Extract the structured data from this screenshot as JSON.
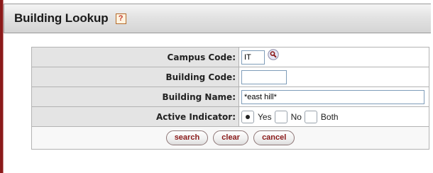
{
  "header": {
    "title": "Building Lookup",
    "help_glyph": "?"
  },
  "form": {
    "fields": [
      {
        "label": "Campus Code:",
        "value": "IT"
      },
      {
        "label": "Building Code:",
        "value": ""
      },
      {
        "label": "Building Name:",
        "value": "*east hill*"
      },
      {
        "label": "Active Indicator:"
      }
    ],
    "active_indicator": {
      "options": [
        {
          "label": "Yes",
          "checked": true
        },
        {
          "label": "No",
          "checked": false
        },
        {
          "label": "Both",
          "checked": false
        }
      ]
    }
  },
  "buttons": {
    "search": "search",
    "clear": "clear",
    "cancel": "cancel"
  },
  "icons": {
    "help": "help-icon",
    "lookup": "magnifier-lookup-icon"
  },
  "colors": {
    "accent": "#8b1a1a",
    "label_bg": "#e4e4e4",
    "input_border": "#7f9db9"
  }
}
